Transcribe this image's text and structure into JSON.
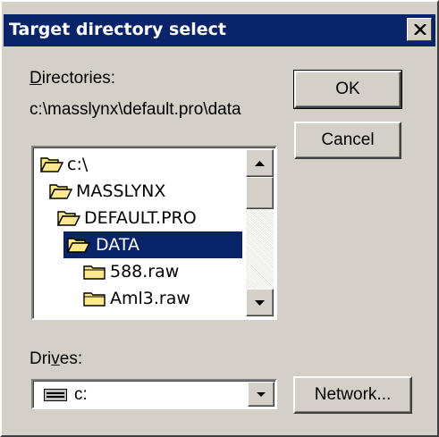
{
  "window": {
    "title": "Target directory select",
    "close_icon": "close-icon"
  },
  "directories": {
    "label_prefix": "D",
    "label_rest": "irectories:",
    "current_path": "c:\\masslynx\\default.pro\\data",
    "items": [
      {
        "name": "c:\\",
        "icon": "open-folder-icon",
        "selected": false
      },
      {
        "name": "MASSLYNX",
        "icon": "open-folder-icon",
        "selected": false
      },
      {
        "name": "DEFAULT.PRO",
        "icon": "open-folder-icon",
        "selected": false
      },
      {
        "name": "DATA",
        "icon": "open-folder-icon",
        "selected": true
      },
      {
        "name": "588.raw",
        "icon": "folder-icon",
        "selected": false
      },
      {
        "name": "Aml3.raw",
        "icon": "folder-icon",
        "selected": false
      }
    ]
  },
  "drives": {
    "label_pre": "Dri",
    "label_underline": "v",
    "label_post": "es:",
    "selected_value": "c:",
    "icon": "drive-icon"
  },
  "buttons": {
    "ok": "OK",
    "cancel": "Cancel",
    "network": "Network..."
  },
  "colors": {
    "titlebar": "#0a246a",
    "selection": "#0a246a",
    "face": "#d4d0c8",
    "folder_fill": "#ffe88c"
  }
}
